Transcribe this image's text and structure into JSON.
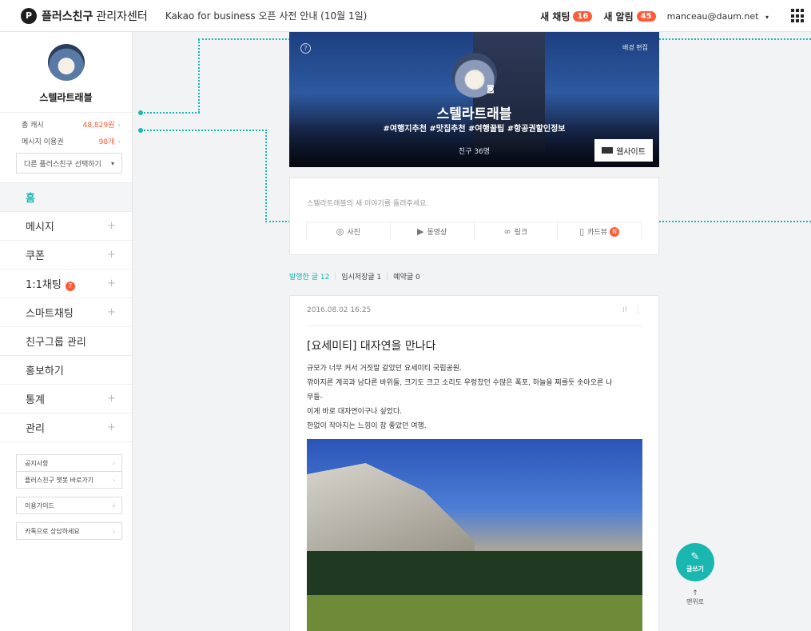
{
  "header": {
    "logo_glyph": "P",
    "brand": "플러스친구",
    "brand_sub": "관리자센터",
    "notice": "Kakao for business 오픈 사전 안내 (10월 1일)",
    "new_chat_label": "새 채팅",
    "new_chat_count": "16",
    "new_alert_label": "새 알림",
    "new_alert_count": "45",
    "account": "manceau@daum.net",
    "account_caret": "▾"
  },
  "sidebar": {
    "profile_name": "스텔라트래블",
    "cash_label": "총 캐시",
    "cash_value": "48,829원",
    "msg_label": "메시지 이용권",
    "msg_value": "98개",
    "chevron": "›",
    "select_label": "다른 플러스친구 선택하기",
    "select_caret": "▾",
    "menu": [
      {
        "label": "홈",
        "plus": ""
      },
      {
        "label": "메시지",
        "plus": "+"
      },
      {
        "label": "쿠폰",
        "plus": "+"
      },
      {
        "label": "1:1채팅",
        "plus": "+",
        "badge": "7"
      },
      {
        "label": "스마트채팅",
        "plus": "+"
      },
      {
        "label": "친구그룹 관리",
        "plus": ""
      },
      {
        "label": "홍보하기",
        "plus": ""
      },
      {
        "label": "통계",
        "plus": "+"
      },
      {
        "label": "관리",
        "plus": "+"
      }
    ],
    "links": {
      "notice": "공지사항",
      "shortcut": "플러스친구 챗봇 바로가기",
      "guide": "이용가이드",
      "consult": "카톡으로 상담하세요",
      "download_glyph": "⤓"
    }
  },
  "cover": {
    "help": "?",
    "bg_edit": "배경 편집",
    "camera_glyph": "◙",
    "name": "스텔라트래블",
    "tags": "#여행지추천 #맛집추천 #여행꿀팁 #항공권할인정보",
    "friends": "친구 36명",
    "website": "웹사이트"
  },
  "composer": {
    "placeholder": "스텔라트래블의 새 이야기를 들려주세요.",
    "tools": {
      "photo": "사진",
      "video": "동영상",
      "link": "링크",
      "card": "카드뷰",
      "new_badge": "N"
    },
    "icons": {
      "photo": "◎",
      "video": "▶",
      "link": "∞",
      "card": "▯"
    }
  },
  "post_tabs": {
    "published": "발행한 글 12",
    "drafts": "임시저장글 1",
    "scheduled": "예약글 0"
  },
  "post": {
    "date": "2016.08.02 16:25",
    "stats_glyph": "ıl",
    "more_glyph": "⋮",
    "title": "[요세미티] 대자연을 만나다",
    "body": [
      "규모가 너무 커서 거짓말 같았던 요세미티 국립공원.",
      "깎아지른 계곡과 남다른 바위들, 크기도 크고 소리도 우렁찼던 수많은 폭포, 하늘을 찌를듯 솟아오른 나",
      "무들-",
      "이게 바로 대자연이구나 싶었다.",
      "한없이 작아지는 느낌이 참 좋았던 여행."
    ]
  },
  "floating": {
    "write": "글쓰기",
    "pen_glyph": "✎",
    "top": "맨위로",
    "up_glyph": "↑"
  },
  "colors": {
    "accent": "#1ab7b0",
    "badge": "#ff5a36"
  }
}
